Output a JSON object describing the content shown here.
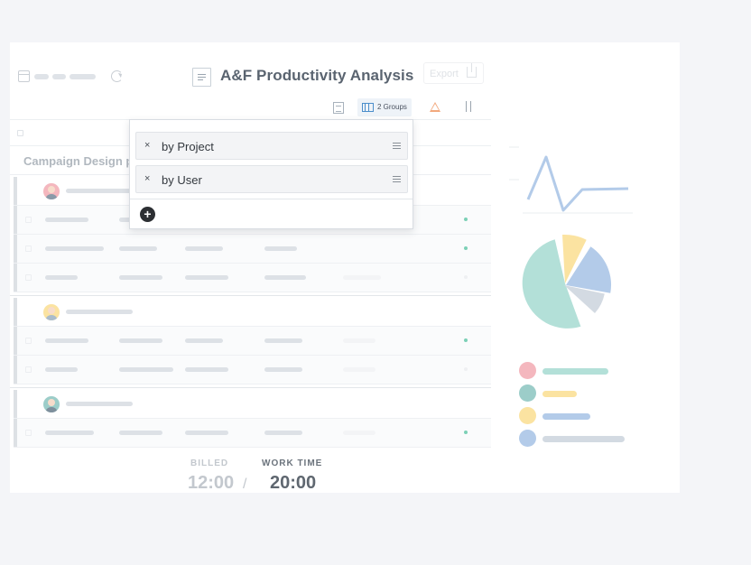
{
  "header": {
    "title": "A&F Productivity Analysis",
    "export_label": "Export"
  },
  "toolbar": {
    "groups_label": "2 Groups"
  },
  "group_by": {
    "items": [
      {
        "remove": "×",
        "label": "by Project"
      },
      {
        "remove": "×",
        "label": "by User"
      }
    ],
    "add": "+"
  },
  "table": {
    "group_title": "Campaign Design p"
  },
  "totals": {
    "billed_label": "BILLED",
    "billed_value": "12:00",
    "separator": "/",
    "work_time_label": "WORK TIME",
    "work_time_value": "20:00"
  },
  "colors": {
    "accent_blue": "#4b8ecb",
    "teal": "#7cd0b6",
    "pie_teal": "#b3e0d8",
    "pie_yellow": "#fbe3a1",
    "pie_blue": "#b3cbe9",
    "pie_gray": "#d3dae2",
    "warning": "#f2a97d"
  },
  "icons": [
    "calendar-icon",
    "refresh-icon",
    "document-icon",
    "export-icon",
    "list-view-icon",
    "columns-icon",
    "warning-icon",
    "sort-icon",
    "close-icon",
    "drag-handle-icon",
    "plus-icon"
  ]
}
